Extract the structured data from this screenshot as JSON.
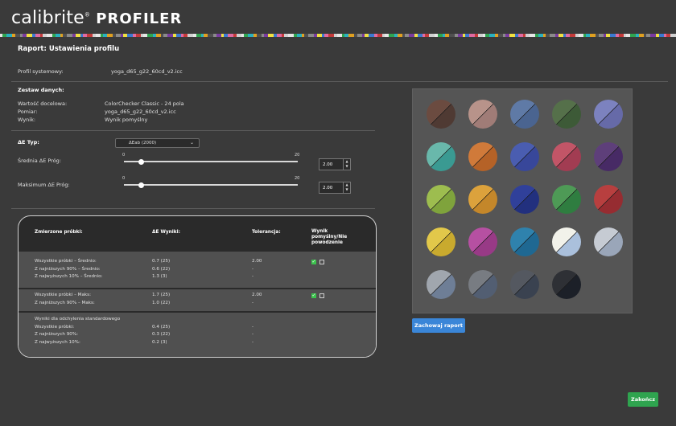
{
  "app": {
    "brand_light": "calibrite",
    "brand_mark": "®",
    "brand_bold": "PROFILER"
  },
  "page_title": "Raport: Ustawienia profilu",
  "profile": {
    "label": "Profil systemowy:",
    "value": "yoga_d65_g22_60cd_v2.icc"
  },
  "dataset": {
    "heading": "Zestaw danych:",
    "rows": [
      {
        "label": "Wartość docelowa:",
        "value": "ColorChecker Classic - 24 pola"
      },
      {
        "label": "Pomiar:",
        "value": "yoga_d65_g22_60cd_v2.icc"
      },
      {
        "label": "Wynik:",
        "value": "Wynik pomyślny"
      }
    ]
  },
  "delta": {
    "type_label": "ΔE Typ:",
    "type_value": "ΔEab (2000)",
    "avg": {
      "label": "Średnia ΔE Próg:",
      "min": "0",
      "max": "20",
      "value": "2.00",
      "fraction": 0.1
    },
    "max": {
      "label": "Maksimum ΔE Próg:",
      "min": "0",
      "max": "20",
      "value": "2.00",
      "fraction": 0.1
    }
  },
  "table": {
    "headers": {
      "col1": "Zmierzone próbki:",
      "col2": "ΔE Wyniki:",
      "col3": "Tolerancja:",
      "col4": "Wynik pomyślny/Nie powodzenie"
    },
    "g1": {
      "labels": [
        "Wszystkie próbki – Średnio:",
        "Z najniższych 90% – Średnio:",
        "Z najwyższych 10% – Średnio:"
      ],
      "values": [
        "0.7 (25)",
        "0.6 (22)",
        "1.3 (3)"
      ],
      "tol": [
        "2.00",
        "-",
        "-"
      ]
    },
    "g2": {
      "labels": [
        "Wszystkie próbki – Maks:",
        "Z najniższych 90% – Maks:"
      ],
      "values": [
        "1.7 (25)",
        "1.0 (22)"
      ],
      "tol": [
        "2.00",
        "-"
      ]
    },
    "g3": {
      "title": "Wyniki dla odchylenia standardowego",
      "labels": [
        "Wszystkie próbki:",
        "Z najniższych 90%:",
        "Z najwyższych 10%:"
      ],
      "values": [
        "0.4 (25)",
        "0.3 (22)",
        "0.2 (3)"
      ],
      "tol": [
        "-",
        "-",
        "-"
      ]
    }
  },
  "patches": [
    [
      "#6b4b40",
      "#4f3a33"
    ],
    [
      "#b8938a",
      "#a07c77"
    ],
    [
      "#5f7aa6",
      "#4a6490"
    ],
    [
      "#55704a",
      "#3d5a37"
    ],
    [
      "#7c82bf",
      "#666aa8"
    ],
    [
      "#69b8ab",
      "#3a9a92"
    ],
    [
      "#d07a3a",
      "#b56227"
    ],
    [
      "#4a5db0",
      "#38479a"
    ],
    [
      "#c25567",
      "#a23c52"
    ],
    [
      "#5e3f7a",
      "#472a65"
    ],
    [
      "#9dbd4f",
      "#7fa33c"
    ],
    [
      "#dca23c",
      "#c4872a"
    ],
    [
      "#30409a",
      "#22307e"
    ],
    [
      "#4e9a56",
      "#2f7d40"
    ],
    [
      "#b83f3f",
      "#962c31"
    ],
    [
      "#e2c84a",
      "#c9aa2e"
    ],
    [
      "#b650a2",
      "#983a86"
    ],
    [
      "#2f82ad",
      "#1f6892"
    ],
    [
      "#f2f2ea",
      "#aac0dc"
    ],
    [
      "#c6cbd3",
      "#9aa6b9"
    ],
    [
      "#a0a6ae",
      "#6e7e96"
    ],
    [
      "#787c82",
      "#525e72"
    ],
    [
      "#545860",
      "#3a4250"
    ],
    [
      "#2e3035",
      "#1c2028"
    ]
  ],
  "buttons": {
    "save_report": "Zachowaj raport",
    "finish": "Zakończ"
  }
}
